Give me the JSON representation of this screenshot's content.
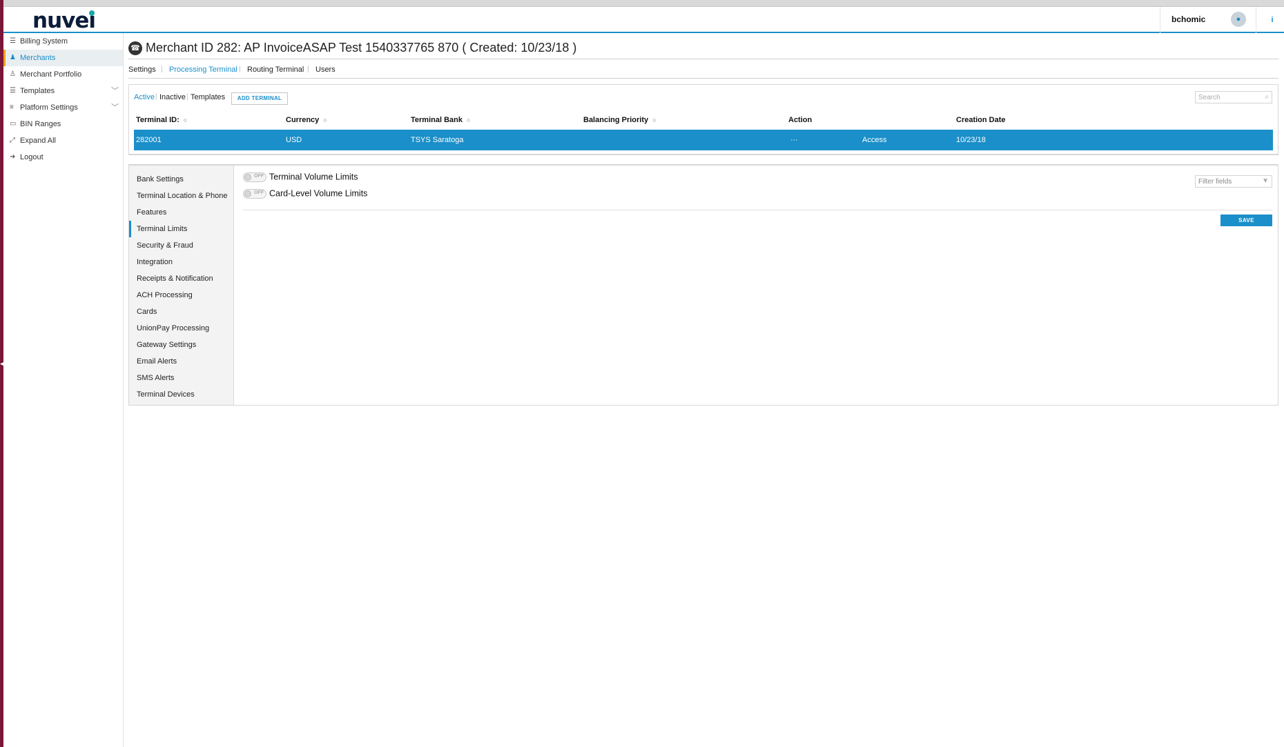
{
  "header": {
    "logo": "nuvei",
    "user_name": "bchomic",
    "info_icon": "info-icon",
    "avatar_icon": "user-icon"
  },
  "sidebar": {
    "items": [
      {
        "label": "Billing System",
        "icon": "list-icon"
      },
      {
        "label": "Merchants",
        "icon": "users-icon",
        "active": true
      },
      {
        "label": "Merchant Portfolio",
        "icon": "user-edit-icon"
      },
      {
        "label": "Templates",
        "icon": "list-icon",
        "expandable": true
      },
      {
        "label": "Platform Settings",
        "icon": "sliders-icon",
        "expandable": true
      },
      {
        "label": "BIN Ranges",
        "icon": "card-icon"
      },
      {
        "label": "Expand All",
        "icon": "expand-icon"
      },
      {
        "label": "Logout",
        "icon": "logout-icon"
      }
    ]
  },
  "page": {
    "title": "Merchant ID 282: AP InvoiceASAP Test 1540337765 870 ( Created: 10/23/18 )",
    "tabs": [
      {
        "label": "Settings",
        "active": false
      },
      {
        "label": "Processing Terminal",
        "active": true
      },
      {
        "label": "Routing Terminal",
        "active": false
      },
      {
        "label": "Users",
        "active": false
      }
    ]
  },
  "terminals": {
    "filters": [
      {
        "label": "Active",
        "active": true
      },
      {
        "label": "Inactive",
        "active": false
      },
      {
        "label": "Templates",
        "active": false
      }
    ],
    "add_button": "ADD TERMINAL",
    "search_placeholder": "Search",
    "columns": [
      "Terminal ID:",
      "Currency",
      "Terminal Bank",
      "Balancing Priority",
      "Action",
      "Creation Date"
    ],
    "rows": [
      {
        "terminal_id": "282001",
        "currency": "USD",
        "terminal_bank": "TSYS Saratoga",
        "balancing_priority": "",
        "action_dots": "···",
        "action": "Access",
        "creation_date": "10/23/18"
      }
    ]
  },
  "settings": {
    "nav": [
      {
        "label": "Bank Settings"
      },
      {
        "label": "Terminal Location & Phone"
      },
      {
        "label": "Features"
      },
      {
        "label": "Terminal Limits",
        "active": true
      },
      {
        "label": "Security & Fraud"
      },
      {
        "label": "Integration"
      },
      {
        "label": "Receipts & Notification"
      },
      {
        "label": "ACH Processing"
      },
      {
        "label": "Cards"
      },
      {
        "label": "UnionPay Processing"
      },
      {
        "label": "Gateway Settings"
      },
      {
        "label": "Email Alerts"
      },
      {
        "label": "SMS Alerts"
      },
      {
        "label": "Terminal Devices"
      }
    ],
    "toggles": [
      {
        "label": "Terminal Volume Limits",
        "state": "OFF"
      },
      {
        "label": "Card-Level Volume Limits",
        "state": "OFF"
      }
    ],
    "filter_placeholder": "Filter fields",
    "save_label": "SAVE"
  },
  "colors": {
    "accent": "#1a8fc9",
    "active_marker": "#f0a11d",
    "left_strip": "#7a1739"
  }
}
